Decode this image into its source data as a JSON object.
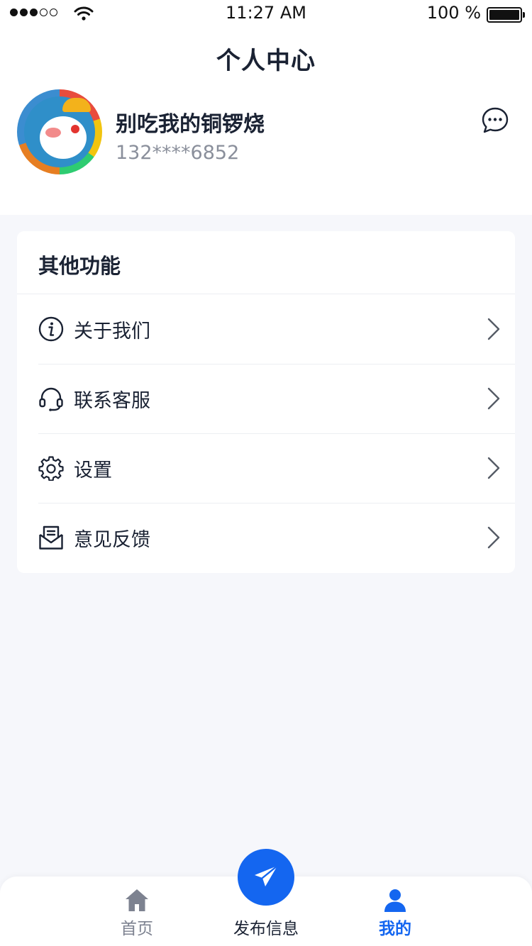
{
  "status_bar": {
    "time": "11:27 AM",
    "battery": "100 %"
  },
  "header": {
    "title": "个人中心"
  },
  "profile": {
    "name": "别吃我的铜锣烧",
    "phone": "132****6852",
    "message_icon": "chat-bubble-icon"
  },
  "card": {
    "title": "其他功能",
    "items": [
      {
        "label": "关于我们",
        "icon": "info-icon"
      },
      {
        "label": "联系客服",
        "icon": "headset-icon"
      },
      {
        "label": "设置",
        "icon": "gear-icon"
      },
      {
        "label": "意见反馈",
        "icon": "mail-feedback-icon"
      }
    ]
  },
  "tab_bar": {
    "home": "首页",
    "publish": "发布信息",
    "mine": "我的"
  },
  "colors": {
    "accent": "#1466f0",
    "background": "#f6f7fb",
    "text": "#1a2233",
    "muted": "#8a8f9b"
  }
}
